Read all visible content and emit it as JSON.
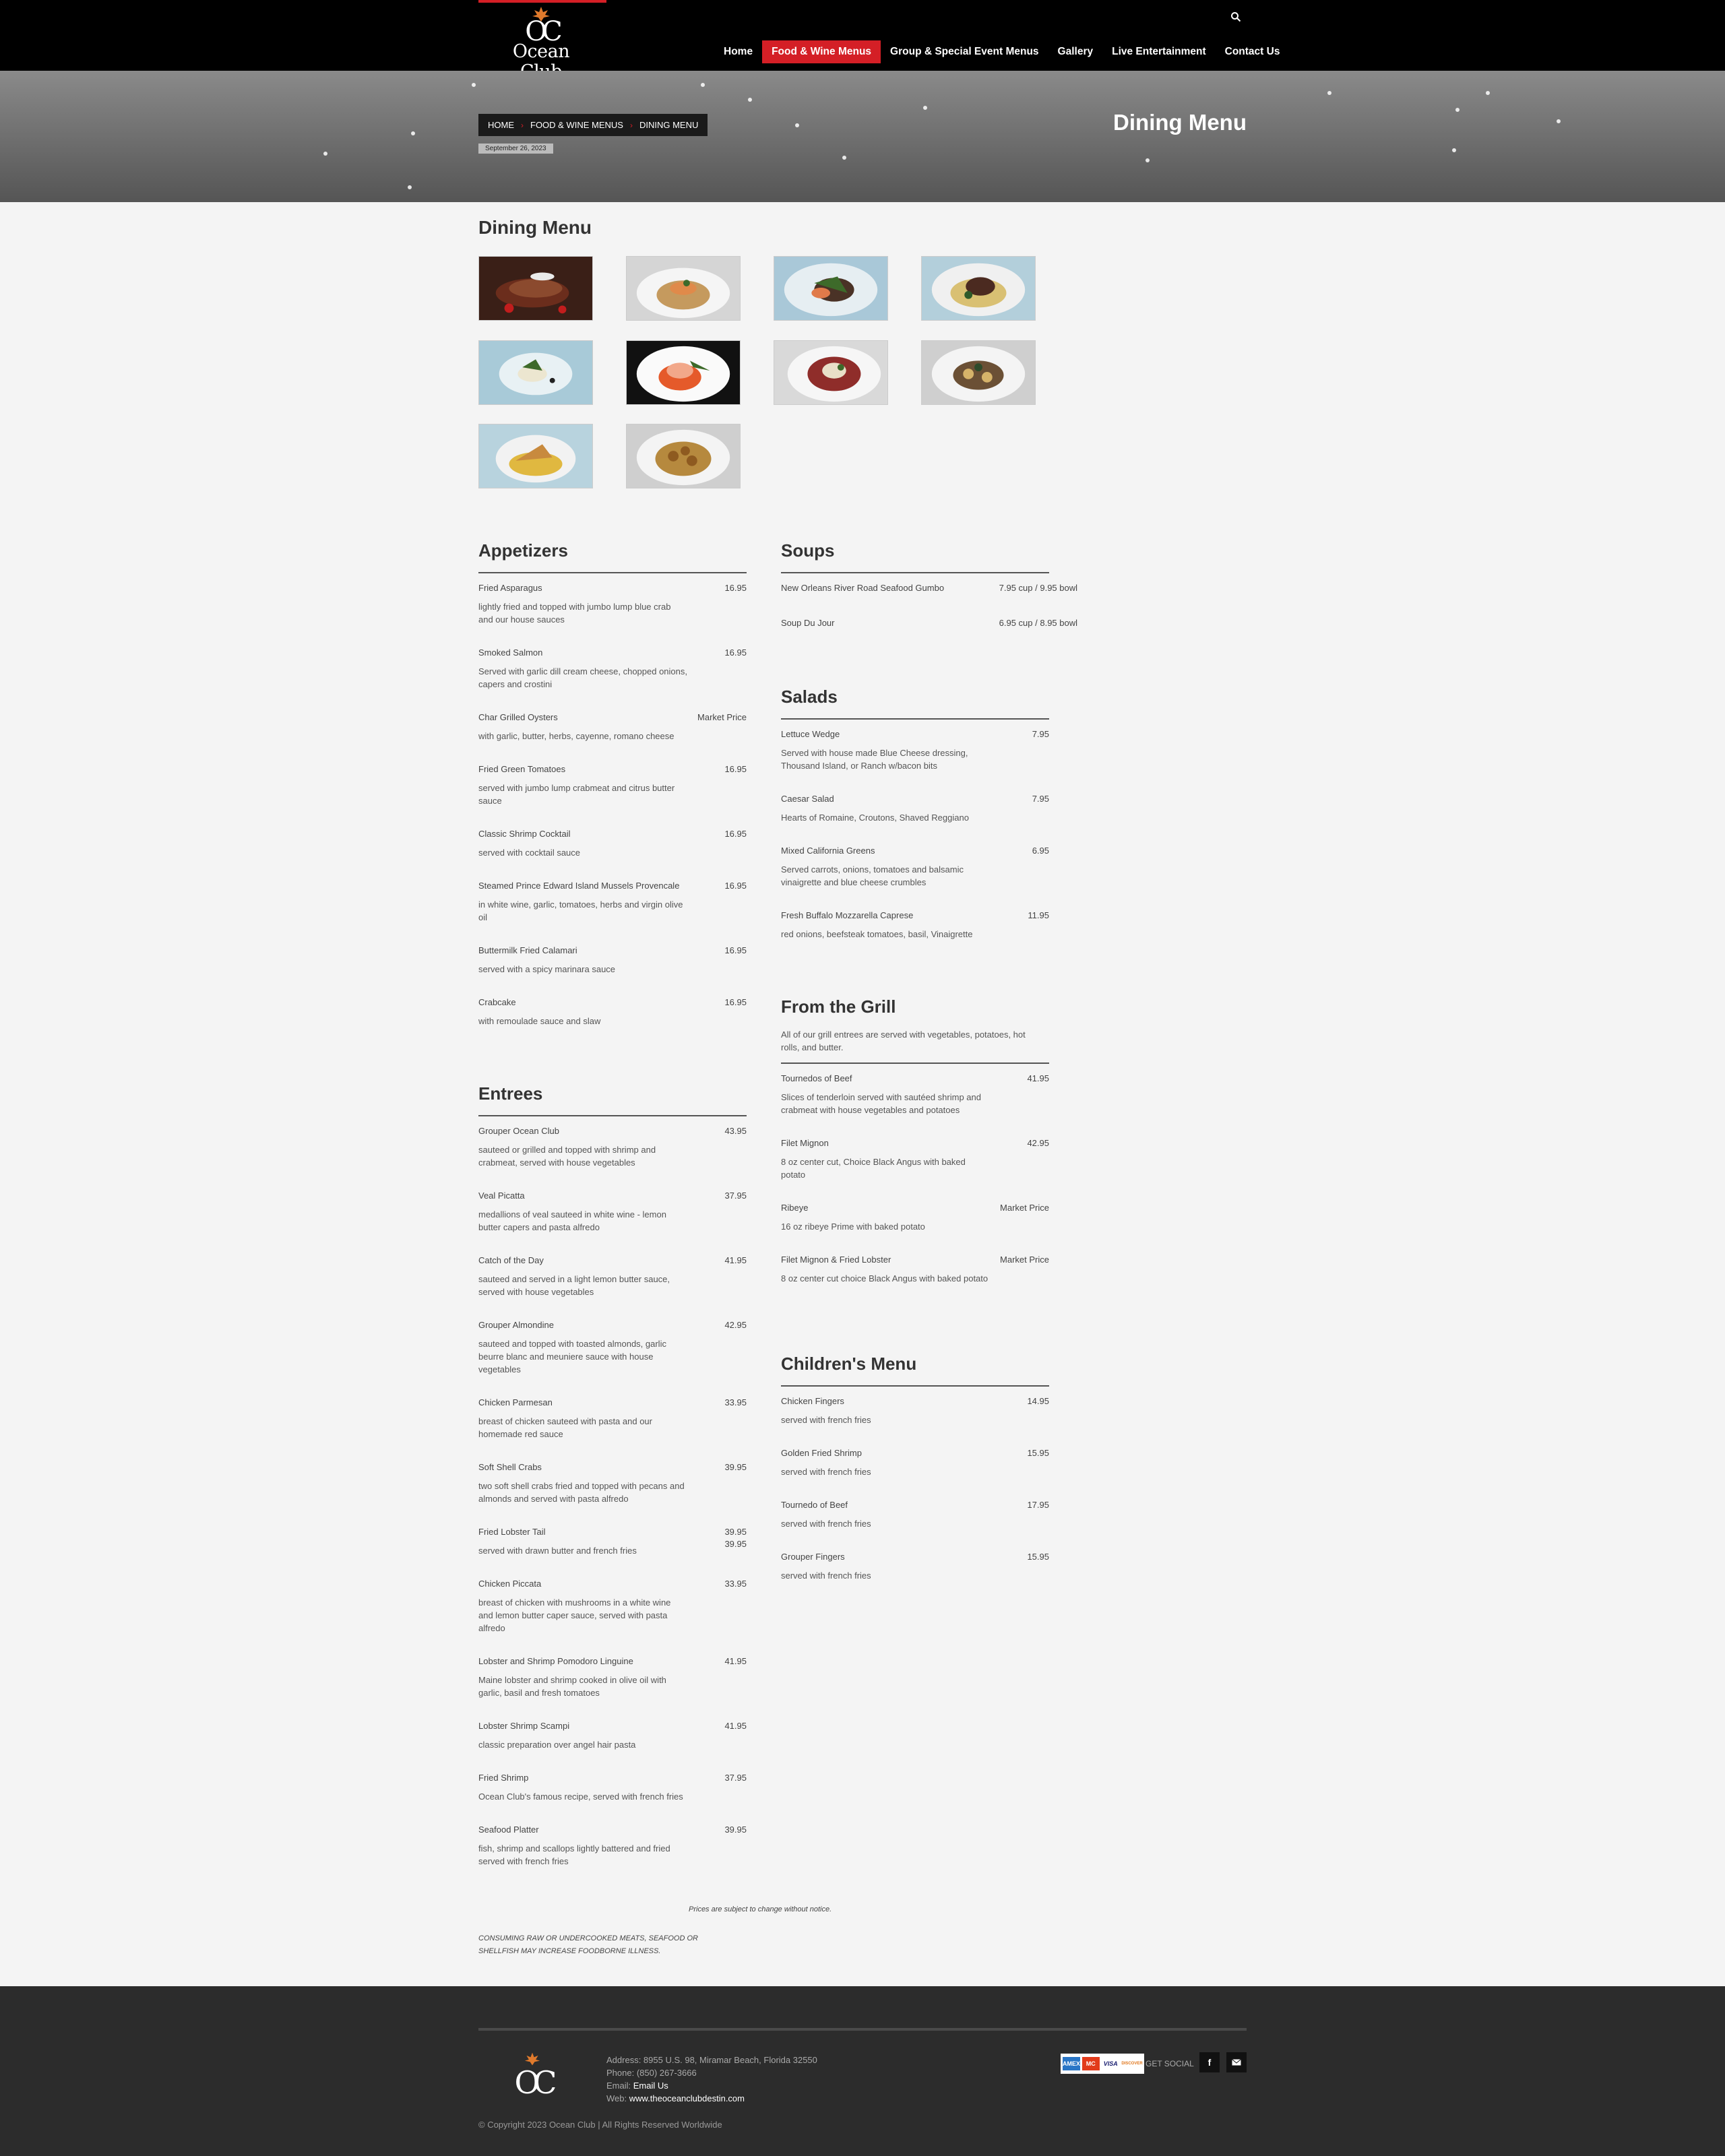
{
  "header": {
    "logo_text": "Ocean Club",
    "logo_monogram": "OC",
    "nav": [
      {
        "label": "Home"
      },
      {
        "label": "Food & Wine Menus"
      },
      {
        "label": "Group & Special Event Menus"
      },
      {
        "label": "Gallery"
      },
      {
        "label": "Live Entertainment"
      },
      {
        "label": "Contact Us"
      }
    ],
    "active_nav": "Food & Wine Menus",
    "accent_color": "#d41f26"
  },
  "banner": {
    "breadcrumb": [
      "HOME",
      "FOOD & WINE MENUS",
      "DINING MENU"
    ],
    "date": "September 26, 2023",
    "title": "Dining Menu"
  },
  "gallery": {
    "heading": "Dining Menu",
    "image_count": 10
  },
  "menu": {
    "appetizers": {
      "title": "Appetizers",
      "items": [
        {
          "name": "Fried Asparagus",
          "price": "16.95",
          "desc": "lightly fried and topped with jumbo lump blue crab and our house sauces"
        },
        {
          "name": "Smoked Salmon",
          "price": "16.95",
          "desc": "Served with garlic dill cream cheese, chopped onions, capers and crostini"
        },
        {
          "name": "Char Grilled Oysters",
          "price": "Market Price",
          "desc": "with garlic, butter, herbs, cayenne, romano cheese"
        },
        {
          "name": "Fried Green Tomatoes",
          "price": "16.95",
          "desc": "served with jumbo lump crabmeat and citrus butter sauce"
        },
        {
          "name": "Classic Shrimp Cocktail",
          "price": "16.95",
          "desc": "served with cocktail sauce"
        },
        {
          "name": "Steamed Prince Edward Island Mussels Provencale",
          "price": "16.95",
          "desc": "in white wine, garlic, tomatoes, herbs and virgin olive oil"
        },
        {
          "name": "Buttermilk Fried Calamari",
          "price": "16.95",
          "desc": "served with a spicy marinara sauce"
        },
        {
          "name": "Crabcake",
          "price": "16.95",
          "desc": "with remoulade sauce and slaw"
        }
      ]
    },
    "entrees": {
      "title": "Entrees",
      "items": [
        {
          "name": "Grouper Ocean Club",
          "price": "43.95",
          "desc": "sauteed or grilled and topped with shrimp and crabmeat, served with house vegetables"
        },
        {
          "name": "Veal Picatta",
          "price": "37.95",
          "desc": "medallions of veal sauteed in white wine - lemon butter capers and pasta alfredo"
        },
        {
          "name": "Catch of the Day",
          "price": "41.95",
          "desc": "sauteed and served in a light lemon butter sauce, served with house vegetables"
        },
        {
          "name": "Grouper Almondine",
          "price": "42.95",
          "desc": "sauteed and topped with toasted almonds, garlic beurre blanc and meuniere sauce with house vegetables"
        },
        {
          "name": "Chicken Parmesan",
          "price": "33.95",
          "desc": "breast of chicken sauteed with pasta and our homemade red sauce"
        },
        {
          "name": "Soft Shell Crabs",
          "price": "39.95",
          "desc": "two soft shell crabs fried and topped with pecans and almonds and served with pasta alfredo"
        },
        {
          "name": "Fried Lobster Tail",
          "price": "39.95",
          "price2": "39.95",
          "desc": "served with drawn butter and french fries"
        },
        {
          "name": "Chicken Piccata",
          "price": "33.95",
          "desc": "breast of chicken with mushrooms in a white wine and lemon butter caper sauce, served with pasta alfredo"
        },
        {
          "name": "Lobster and Shrimp Pomodoro Linguine",
          "price": "41.95",
          "desc": "Maine lobster and shrimp cooked in olive oil with garlic, basil and fresh tomatoes"
        },
        {
          "name": "Lobster Shrimp Scampi",
          "price": "41.95",
          "desc": "classic preparation over angel hair pasta"
        },
        {
          "name": "Fried Shrimp",
          "price": "37.95",
          "desc": "Ocean Club's famous recipe, served with french fries"
        },
        {
          "name": "Seafood Platter",
          "price": "39.95",
          "desc": "fish, shrimp and scallops lightly battered and fried served with french fries"
        }
      ]
    },
    "soups": {
      "title": "Soups",
      "items": [
        {
          "name": "New Orleans River Road Seafood Gumbo",
          "price": "7.95 cup / 9.95 bowl"
        },
        {
          "name": "Soup Du Jour",
          "price": "6.95 cup / 8.95 bowl"
        }
      ]
    },
    "salads": {
      "title": "Salads",
      "items": [
        {
          "name": "Lettuce Wedge",
          "price": "7.95",
          "desc": "Served with house made Blue Cheese dressing, Thousand Island, or Ranch w/bacon bits"
        },
        {
          "name": "Caesar Salad",
          "price": "7.95",
          "desc": "Hearts of Romaine, Croutons, Shaved Reggiano"
        },
        {
          "name": "Mixed California Greens",
          "price": "6.95",
          "desc": "Served carrots, onions, tomatoes and balsamic vinaigrette and blue cheese crumbles"
        },
        {
          "name": "Fresh Buffalo Mozzarella Caprese",
          "price": "11.95",
          "desc": "red onions, beefsteak tomatoes, basil, Vinaigrette"
        }
      ]
    },
    "grill": {
      "title": "From the Grill",
      "note": "All of our grill entrees are served with vegetables, potatoes, hot rolls, and butter.",
      "items": [
        {
          "name": "Tournedos of Beef",
          "price": "41.95",
          "desc": "Slices of tenderloin served with sautéed shrimp and crabmeat with house vegetables and potatoes"
        },
        {
          "name": "Filet Mignon",
          "price": "42.95",
          "desc": "8 oz center cut, Choice Black Angus with baked potato"
        },
        {
          "name": "Ribeye",
          "price": "Market Price",
          "desc": "16 oz ribeye Prime with baked potato"
        },
        {
          "name": "Filet Mignon & Fried Lobster",
          "price": "Market Price",
          "desc": "8 oz center cut choice Black Angus with baked potato"
        }
      ]
    },
    "childrens": {
      "title": "Children's Menu",
      "items": [
        {
          "name": "Chicken Fingers",
          "price": "14.95",
          "desc": "served with french fries"
        },
        {
          "name": "Golden Fried Shrimp",
          "price": "15.95",
          "desc": "served with french fries"
        },
        {
          "name": "Tournedo of Beef",
          "price": "17.95",
          "desc": "served with french fries"
        },
        {
          "name": "Grouper Fingers",
          "price": "15.95",
          "desc": "served with french fries"
        }
      ]
    }
  },
  "notices": {
    "price_notice": "Prices are subject to change without notice.",
    "warning": "CONSUMING RAW OR UNDERCOOKED MEATS, SEAFOOD OR SHELLFISH MAY INCREASE FOODBORNE ILLNESS."
  },
  "footer": {
    "address": "Address: 8955 U.S. 98, Miramar Beach, Florida 32550",
    "phone": "Phone: (850) 267-3666",
    "email_label": "Email:",
    "email_link": "Email Us",
    "web_label": "Web:",
    "web_link": "www.theoceanclubdestin.com",
    "cards": [
      "AMEX",
      "MC",
      "VISA",
      "DISCOVER"
    ],
    "get_social": "GET SOCIAL",
    "copyright": "© Copyright 2023 Ocean Club | All Rights Reserved Worldwide"
  }
}
